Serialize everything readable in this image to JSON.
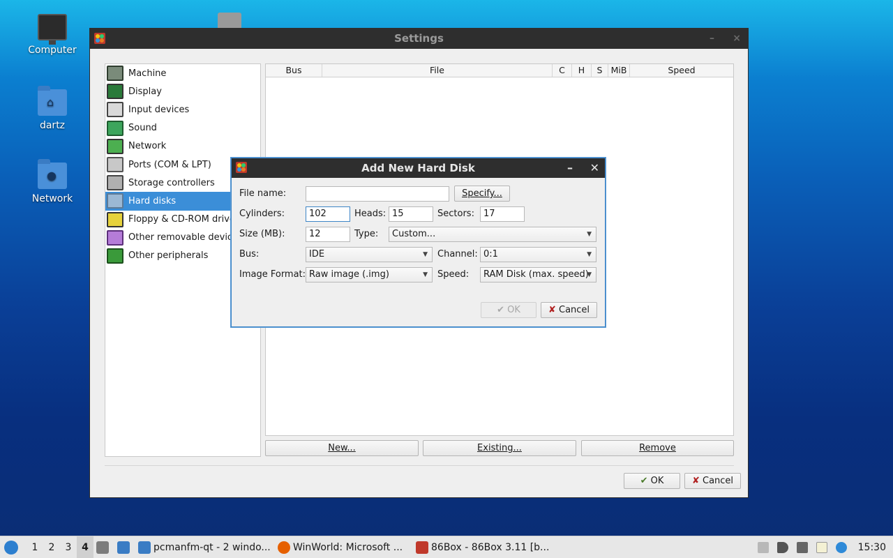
{
  "desktop": {
    "icons": [
      {
        "label": "Computer"
      },
      {
        "label": "dartz"
      },
      {
        "label": "Network"
      }
    ]
  },
  "settings": {
    "title": "Settings",
    "categories": [
      {
        "label": "Machine",
        "icon": "chip-icon"
      },
      {
        "label": "Display",
        "icon": "display-icon"
      },
      {
        "label": "Input devices",
        "icon": "keyboard-icon"
      },
      {
        "label": "Sound",
        "icon": "speaker-icon"
      },
      {
        "label": "Network",
        "icon": "network-icon"
      },
      {
        "label": "Ports (COM & LPT)",
        "icon": "port-icon"
      },
      {
        "label": "Storage controllers",
        "icon": "storage-icon"
      },
      {
        "label": "Hard disks",
        "icon": "hdd-icon"
      },
      {
        "label": "Floppy & CD-ROM drives",
        "icon": "floppy-icon"
      },
      {
        "label": "Other removable devices",
        "icon": "removable-icon"
      },
      {
        "label": "Other peripherals",
        "icon": "peripheral-icon"
      }
    ],
    "selected_category": "Hard disks",
    "table_columns": [
      "Bus",
      "File",
      "C",
      "H",
      "S",
      "MiB",
      "Speed"
    ],
    "buttons": {
      "new": "New...",
      "existing": "Existing...",
      "remove": "Remove",
      "ok": "OK",
      "cancel": "Cancel"
    }
  },
  "dialog": {
    "title": "Add New Hard Disk",
    "file_name_label": "File name:",
    "file_name_value": "",
    "specify_button": "Specify...",
    "cylinders_label": "Cylinders:",
    "cylinders_value": "102",
    "heads_label": "Heads:",
    "heads_value": "15",
    "sectors_label": "Sectors:",
    "sectors_value": "17",
    "size_label": "Size (MB):",
    "size_value": "12",
    "type_label": "Type:",
    "type_value": "Custom...",
    "bus_label": "Bus:",
    "bus_value": "IDE",
    "channel_label": "Channel:",
    "channel_value": "0:1",
    "format_label": "Image Format:",
    "format_value": "Raw image (.img)",
    "speed_label": "Speed:",
    "speed_value": "RAM Disk (max. speed)",
    "ok_button": "OK",
    "cancel_button": "Cancel"
  },
  "taskbar": {
    "workspaces": [
      "1",
      "2",
      "3",
      "4"
    ],
    "active_workspace": "4",
    "tasks": [
      {
        "label": "pcmanfm-qt - 2 windo..."
      },
      {
        "label": "WinWorld: Microsoft ..."
      },
      {
        "label": "86Box - 86Box 3.11 [b..."
      }
    ],
    "clock": "15:30"
  }
}
